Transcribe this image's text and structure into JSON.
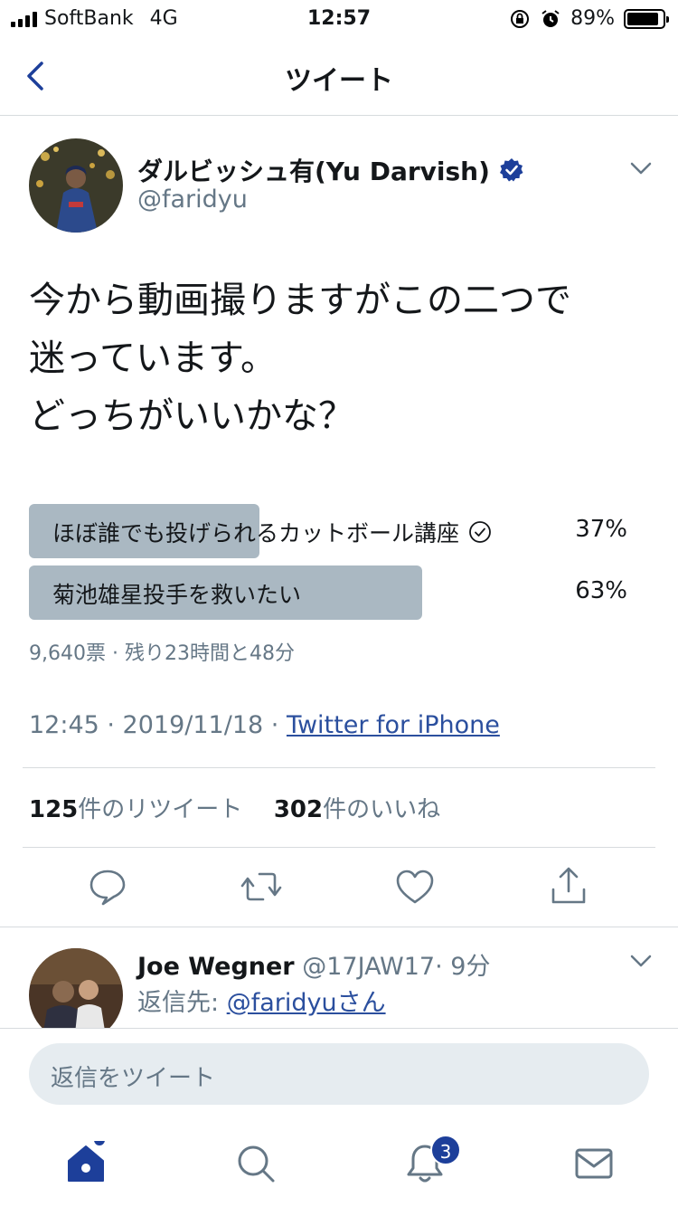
{
  "status_bar": {
    "carrier": "SoftBank",
    "network": "4G",
    "time": "12:57",
    "battery": "89%",
    "battery_level": 0.89
  },
  "header": {
    "title": "ツイート"
  },
  "tweet": {
    "author": {
      "name": "ダルビッシュ有(Yu Darvish)",
      "handle": "@faridyu"
    },
    "text_lines": [
      "今から動画撮りますがこの二つで",
      "迷っています。",
      "どっちがいいかな？"
    ],
    "poll": {
      "options": [
        {
          "label": "ほぼ誰でも投げられるカットボール講座",
          "percent": "37%",
          "value": 0.37,
          "selected": true
        },
        {
          "label": "菊池雄星投手を救いたい",
          "percent": "63%",
          "value": 0.63,
          "selected": false
        }
      ],
      "meta": "9,640票 · 残り23時間と48分"
    },
    "timestamp": "12:45 · 2019/11/18 · ",
    "source": "Twitter for iPhone",
    "stats": {
      "retweets_count": "125",
      "retweets_label": "件のリツイート",
      "likes_count": "302",
      "likes_label": "件のいいね"
    }
  },
  "reply": {
    "name": "Joe Wegner",
    "handle": "@17JAW17",
    "time": "· 9分",
    "reply_to_label": "返信先: ",
    "reply_to_link": "@faridyuさん"
  },
  "compose": {
    "placeholder": "返信をツイート"
  },
  "tab_bar": {
    "notifications_badge": "3"
  },
  "colors": {
    "accent": "#1d3f9a",
    "link": "#2b4f9e",
    "poll_bar": "#aab8c2",
    "muted_text": "#657786",
    "verified": "#1d3f9a"
  },
  "icons": {
    "back": "chevron-left-icon",
    "verified": "verified-badge-icon",
    "more": "chevron-down-icon",
    "reply": "comment-icon",
    "retweet": "retweet-icon",
    "like": "heart-icon",
    "share": "share-icon",
    "home": "home-icon",
    "search": "search-icon",
    "notifications": "bell-icon",
    "messages": "mail-icon"
  }
}
